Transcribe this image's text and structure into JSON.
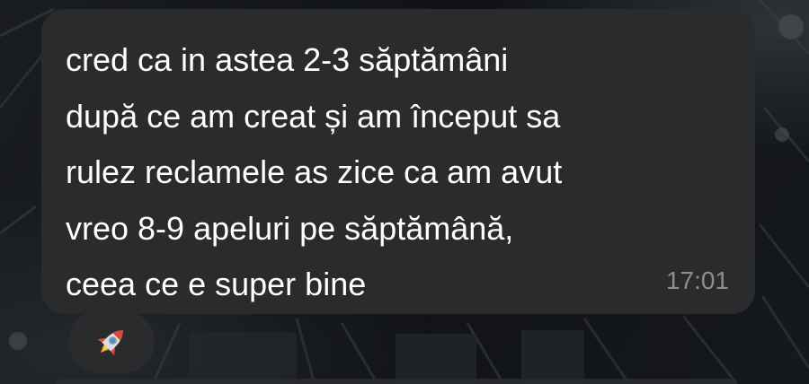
{
  "message": {
    "lines": [
      "cred ca in astea 2-3 săptămâni",
      "după ce am creat și am început sa",
      "rulez reclamele as zice ca am avut",
      "vreo 8-9 apeluri pe săptămână,",
      "ceea ce e super bine"
    ],
    "time": "17:01",
    "reaction_icon": "rocket-icon"
  },
  "colors": {
    "bubble": "#2a2b2d",
    "text": "#ffffff",
    "timestamp": "#8d8e90",
    "background": "#0e1013"
  }
}
